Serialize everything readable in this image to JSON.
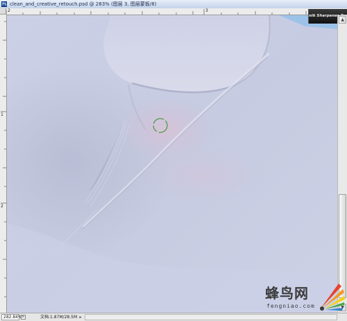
{
  "window": {
    "title": "clean_and_creative_retouch.psd @ 283% (图层 3, 图层蒙板/8)",
    "doc_icon_glyph": "Ps"
  },
  "plugin": {
    "label": "nik Sharpener Pro"
  },
  "status": {
    "zoom": "282.84%",
    "doc_info": "文档:1.87M/28.5M",
    "nav_glyph": "⊳",
    "menu_arrow_glyph": "▸"
  },
  "rulers": {
    "top_marks": [
      "2",
      "3"
    ],
    "left_marks": [
      "1",
      "2"
    ]
  },
  "scrollbar": {
    "up_glyph": "▲",
    "down_glyph": "▼"
  },
  "watermark": {
    "chinese": "蜂鸟网",
    "english": "fengniao.com"
  },
  "colors": {
    "skin_base": "#c8cde3",
    "skin_pink": "#d7c6d9",
    "sky": "#9cc2e8",
    "brush_cursor": "#4f9a4a"
  }
}
